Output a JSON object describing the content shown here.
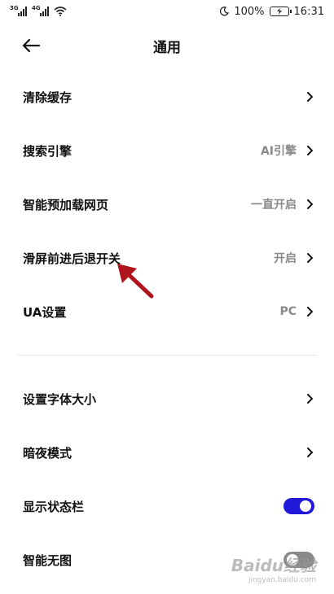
{
  "status_bar": {
    "network_1": "3G",
    "network_2": "4G",
    "battery_label": "100%",
    "time": "16:31",
    "icons": [
      "signal-icon",
      "wifi-icon",
      "moon-icon",
      "battery-icon"
    ]
  },
  "header": {
    "title": "通用",
    "back_icon": "arrow-left-icon"
  },
  "settings": [
    {
      "label": "清除缓存",
      "value": ""
    },
    {
      "label": "搜索引擎",
      "value": "AI引擎"
    },
    {
      "label": "智能预加载网页",
      "value": "一直开启"
    },
    {
      "label": "滑屏前进后退开关",
      "value": "开启"
    },
    {
      "label": "UA设置",
      "value": "PC"
    }
  ],
  "settings2": [
    {
      "label": "设置字体大小"
    },
    {
      "label": "暗夜模式"
    }
  ],
  "toggles": [
    {
      "label": "显示状态栏",
      "on": true
    },
    {
      "label": "智能无图",
      "on": false
    }
  ],
  "watermark": {
    "main": "Baidu经验",
    "sub": "jingyan.baidu.com"
  },
  "colors": {
    "toggle_on": "#2219d8",
    "toggle_off": "#8a8a8a",
    "annotation_arrow": "#b0141c"
  }
}
